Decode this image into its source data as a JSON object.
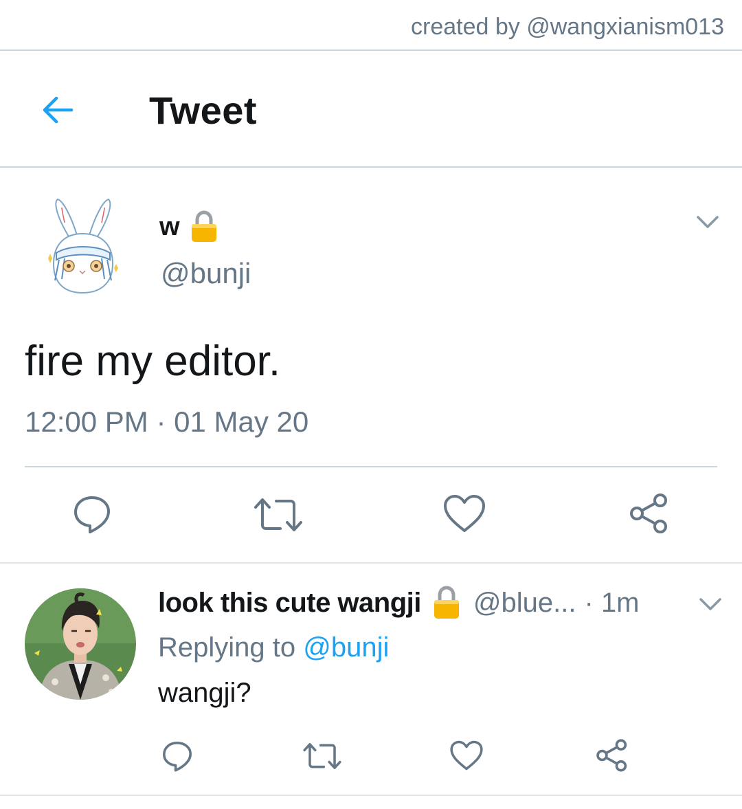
{
  "credit": {
    "text": "created by @wangxianism013"
  },
  "header": {
    "title": "Tweet",
    "back_icon": "arrow-left-icon"
  },
  "tweet": {
    "author_name": "w",
    "protected_icon": "lock-icon",
    "handle": "@bunji",
    "text": "fire my editor.",
    "timestamp": "12:00 PM · 01 May 20",
    "actions": [
      "reply-icon",
      "retweet-icon",
      "like-icon",
      "share-icon"
    ]
  },
  "reply": {
    "author_name": "look this cute wangji",
    "handle": "@blue...",
    "time": "· 1m",
    "replying_prefix": "Replying to ",
    "replying_mention": "@bunji",
    "text": "wangji?"
  },
  "colors": {
    "accent": "#1da1f2",
    "secondary_text": "#657786",
    "border": "#ccd6dd",
    "lock_gold": "#f7b500"
  }
}
